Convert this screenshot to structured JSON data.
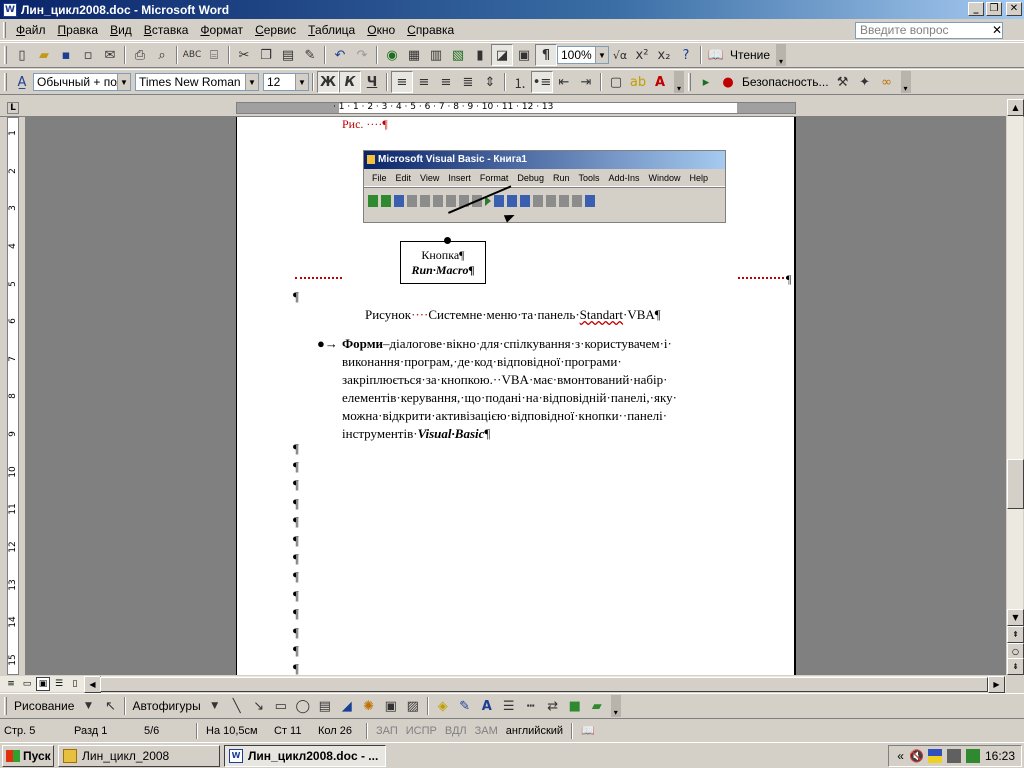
{
  "window": {
    "title": "Лин_цикл2008.doc - Microsoft Word",
    "app_icon": "W",
    "buttons": [
      "_",
      "❐",
      "✕"
    ]
  },
  "menubar": {
    "items": [
      "Файл",
      "Правка",
      "Вид",
      "Вставка",
      "Формат",
      "Сервис",
      "Таблица",
      "Окно",
      "Справка"
    ],
    "ask_placeholder": "Введите вопрос",
    "close": "✕"
  },
  "standard_toolbar": {
    "zoom": "100%",
    "reading_label": "Чтение"
  },
  "formatting_toolbar": {
    "style": "Обычный + пол",
    "font": "Times New Roman",
    "size": "12",
    "bold": "Ж",
    "italic": "К",
    "underline": "Ч",
    "security_label": "Безопасность..."
  },
  "ruler": {
    "corner": "L",
    "numbers": "· 1 · 1 · 2 · 3 · 4 · 5 · 6 · 7 · 8 · 9 · 10 · 11 · 12 · 13",
    "vertical_numbers": [
      "1",
      "2",
      "3",
      "4",
      "5",
      "6",
      "7",
      "8",
      "9",
      "10",
      "11",
      "12",
      "13",
      "14",
      "15"
    ]
  },
  "document": {
    "caption_top": "Рис. ····¶",
    "vba_window": {
      "title": "Microsoft Visual Basic - Книга1",
      "menu": [
        "File",
        "Edit",
        "View",
        "Insert",
        "Format",
        "Debug",
        "Run",
        "Tools",
        "Add-Ins",
        "Window",
        "Help"
      ]
    },
    "callout_line1": "Кнопка¶",
    "callout_line2": "Run·Macro¶",
    "pilcrow": "¶",
    "figure_caption_prefix": "Рисунок",
    "figure_caption_dots": "····",
    "figure_caption_body": "Системне·меню·та·панель·",
    "figure_caption_underlined": "Standart",
    "figure_caption_end": "·VBA¶",
    "bullet_symbol": "●→",
    "bullet_bold": "Форми",
    "bullet_text": "–діалогове·вікно·для·спілкування·з·користувачем·і· виконання·програм,·де·код·відповідної·програми· закріплюється·за·кнопкою.··VBA·має·вмонтований·набір· елементів·керування,·що·подані·на·відповідній·панелі,·яку· можна·відкрити·активізацією·відповідної·кнопки··панелі· інструментів·",
    "bullet_italic": "Visual·Basic",
    "bullet_end": "¶"
  },
  "drawing_toolbar": {
    "draw_label": "Рисование",
    "autoshapes_label": "Автофигуры"
  },
  "statusbar": {
    "page": "Стр. 5",
    "section": "Разд 1",
    "pages": "5/6",
    "at": "На 10,5см",
    "line": "Ст 11",
    "col": "Кол 26",
    "rec": "ЗАП",
    "trk": "ИСПР",
    "ext": "ВДЛ",
    "ovr": "ЗАМ",
    "language": "английский"
  },
  "taskbar": {
    "start_label": "Пуск",
    "tasks": [
      "Лин_цикл_2008",
      "Лин_цикл2008.doc - ..."
    ],
    "clock": "16:23",
    "tray_arrow": "«"
  }
}
